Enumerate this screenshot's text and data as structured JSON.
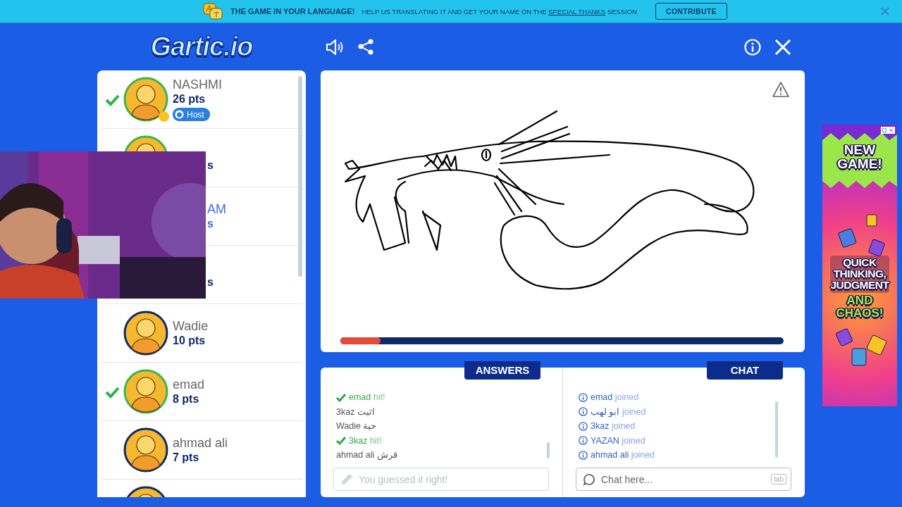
{
  "banner": {
    "headline": "THE GAME IN YOUR LANGUAGE!",
    "message": {
      "before": "HELP US TRANSLATING IT AND GET YOUR NAME ON THE",
      "link": "SPECIAL THANKS",
      "after": "SESSION"
    },
    "button": "CONTRIBUTE"
  },
  "logo": "Gartic.io",
  "players": [
    {
      "kind": "player",
      "name": "NASHMI",
      "points": "26 pts",
      "badge": "Host",
      "checked": true,
      "drawing": false
    },
    {
      "kind": "covered",
      "points": "s",
      "checked": true,
      "drawing": false
    },
    {
      "kind": "covered",
      "name": "AM",
      "points": "s",
      "drawing": true
    },
    {
      "kind": "covered",
      "points": "s",
      "drawing": false
    },
    {
      "kind": "player",
      "name": "Wadie",
      "points": "10 pts",
      "checked": false,
      "drawing": false
    },
    {
      "kind": "player",
      "name": "emad",
      "points": "8 pts",
      "checked": true,
      "drawing": false
    },
    {
      "kind": "player",
      "name": "ahmad ali",
      "points": "7 pts",
      "checked": false,
      "drawing": false
    },
    {
      "kind": "avatar_only",
      "checked": false
    }
  ],
  "canvas": {
    "timer": {
      "level": 0.09
    }
  },
  "answers": {
    "title": "ANSWERS",
    "items": [
      {
        "kind": "hit",
        "name": "emad",
        "text": "hit!"
      },
      {
        "kind": "guess",
        "name": "3kaz",
        "text": "اثيت"
      },
      {
        "kind": "guess",
        "name": "Wadie",
        "text": "حية"
      },
      {
        "kind": "hit",
        "name": "3kaz",
        "text": "hit!"
      },
      {
        "kind": "guess",
        "name": "ahmad ali",
        "text": "قرش"
      }
    ],
    "placeholder": "You guessed it right!",
    "disabled": true
  },
  "chat": {
    "title": "CHAT",
    "items": [
      {
        "kind": "join",
        "name": "emad",
        "text": "joined"
      },
      {
        "kind": "join",
        "name": "ابو لهب",
        "text": "joined"
      },
      {
        "kind": "join",
        "name": "3kaz",
        "text": "joined"
      },
      {
        "kind": "join",
        "name": "YAZAN",
        "text": "joined"
      },
      {
        "kind": "join",
        "name": "ahmad ali",
        "text": "joined"
      }
    ],
    "placeholder": "Chat here...",
    "key_hint": "tab"
  },
  "ad": {
    "headline": [
      "NEW",
      "GAME!"
    ],
    "lines": [
      "QUICK",
      "THINKING,",
      "JUDGMENT"
    ],
    "accent_lines": [
      "AND",
      "CHAOS!"
    ]
  }
}
